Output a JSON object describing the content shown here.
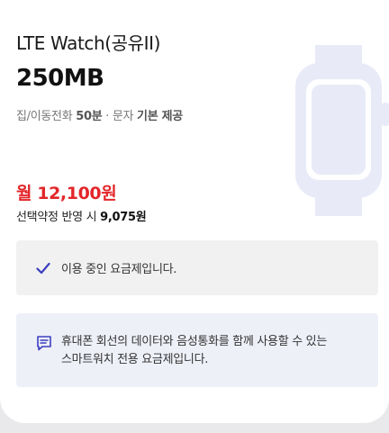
{
  "plan": {
    "name": "LTE Watch(공유II)",
    "data": "250MB",
    "desc": {
      "prefix": "집/이동전화 ",
      "minutes": "50분",
      "sep": " · 문자 ",
      "basic": "기본 제공"
    }
  },
  "price": {
    "monthly": "월 12,100원",
    "contract_prefix": "선택약정 반영 시 ",
    "contract_value": "9,075원"
  },
  "status": {
    "text": "이용 중인 요금제입니다."
  },
  "info": {
    "line1": "휴대폰 회선의 데이터와 음성통화를 함께 사용할 수 있는",
    "line2": "스마트워치 전용 요금제입니다."
  },
  "colors": {
    "price": "#e3262a",
    "accent": "#3b3fbf",
    "watch_bg": "#e8ebf7",
    "info_bg": "#eef0f8",
    "status_bg": "#f1f1f1"
  },
  "icons": {
    "graphic": "smartwatch-icon",
    "status": "check-icon",
    "info": "message-icon"
  }
}
